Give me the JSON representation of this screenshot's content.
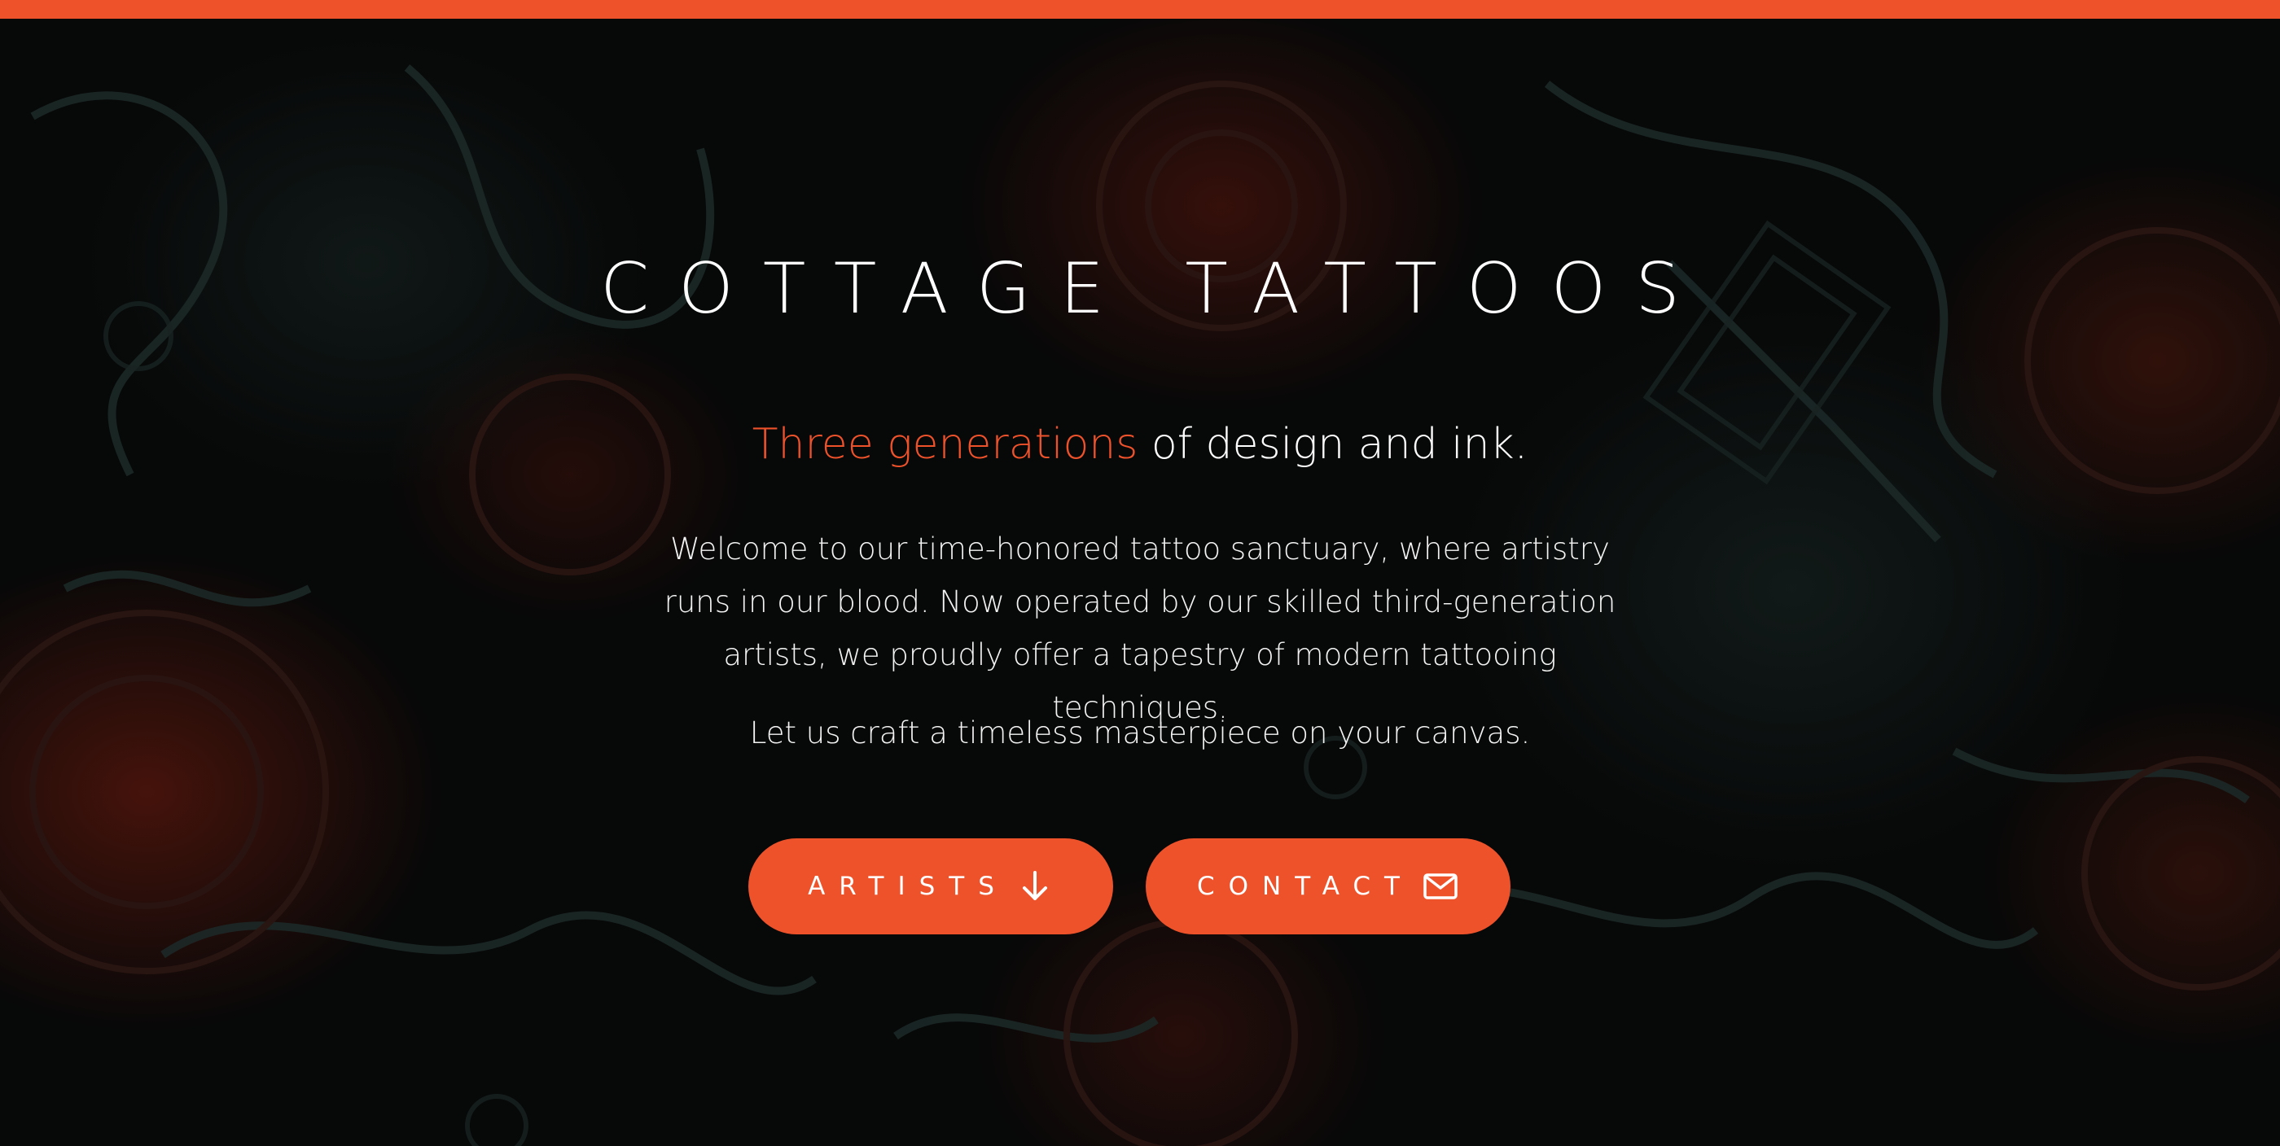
{
  "page": {
    "title": "COTTAGE TATTOOS",
    "accent_color": "#ee522b",
    "background_color": "#070808",
    "text_color": "#ffffff"
  },
  "hero": {
    "tagline_accent": "Three generations",
    "tagline_rest": " of design and ink.",
    "intro": "Welcome to our time-honored tattoo sanctuary, where artistry runs in our blood. Now operated by our skilled third-generation artists, we proudly offer a tapestry of modern tattooing techniques.",
    "cta_text": "Let us craft a timeless masterpiece on your canvas."
  },
  "buttons": {
    "artists": {
      "label": "ARTISTS",
      "icon": "arrow-down-icon"
    },
    "contact": {
      "label": "CONTACT",
      "icon": "envelope-icon"
    }
  }
}
